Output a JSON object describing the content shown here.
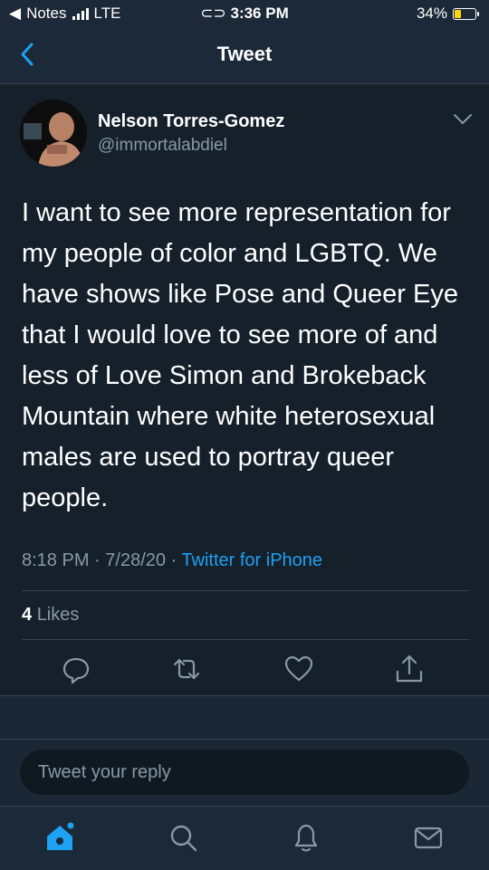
{
  "status_bar": {
    "back_app": "Notes",
    "carrier": "LTE",
    "time": "3:36 PM",
    "battery": "34%",
    "battery_level": 0.34,
    "battery_color": "#ffd60a"
  },
  "nav": {
    "title": "Tweet",
    "back_icon": "chevron-left-icon"
  },
  "tweet": {
    "author_name": "Nelson Torres-Gomez",
    "author_handle": "@immortalabdiel",
    "text": "I want to see more representation for my people of color and LGBTQ. We have shows like Pose and Queer Eye that I would love to see more of and less of Love Simon and Brokeback Mountain where white heterosexual males are used to portray queer people.",
    "time": "8:18 PM",
    "date": "7/28/20",
    "source": "Twitter for iPhone",
    "likes_count": "4",
    "likes_label": "Likes"
  },
  "actions": [
    "reply-icon",
    "retweet-icon",
    "like-icon",
    "share-icon"
  ],
  "reply": {
    "placeholder": "Tweet your reply"
  },
  "tabs": [
    "home-icon",
    "search-icon",
    "notifications-icon",
    "messages-icon"
  ],
  "colors": {
    "background": "#15202b",
    "accent": "#1da1f2",
    "secondary_text": "#8899a6"
  }
}
